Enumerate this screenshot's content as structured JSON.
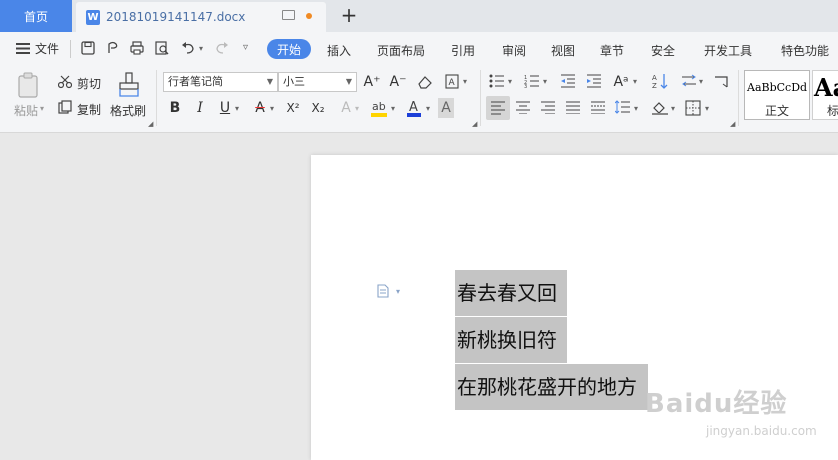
{
  "titlebar": {
    "home_tab": "首页",
    "doc_tab": {
      "filename": "20181019141147.docx",
      "app_icon_letter": "W",
      "unsaved_dot_color": "#f08a24"
    },
    "new_tab_symbol": "+"
  },
  "menubar": {
    "file_label": "文件",
    "tabs": [
      {
        "label": "开始"
      },
      {
        "label": "插入"
      },
      {
        "label": "页面布局"
      },
      {
        "label": "引用"
      },
      {
        "label": "审阅"
      },
      {
        "label": "视图"
      },
      {
        "label": "章节"
      },
      {
        "label": "安全"
      },
      {
        "label": "开发工具"
      },
      {
        "label": "特色功能"
      }
    ]
  },
  "ribbon": {
    "paste_label": "粘贴",
    "cut_label": "剪切",
    "copy_label": "复制",
    "format_painter_label": "格式刷",
    "font_family": "行者笔记简",
    "font_size": "小三",
    "bold": "B",
    "italic": "I",
    "underline": "U",
    "strike": "A",
    "superscript": "X²",
    "subscript": "X₂",
    "grow_font": "A⁺",
    "shrink_font": "A⁻",
    "font_color_letter": "A",
    "styles": [
      {
        "preview": "AaBbCcDd",
        "name": "正文"
      },
      {
        "preview": "Aa",
        "name": "标"
      }
    ]
  },
  "document": {
    "lines": [
      {
        "text": "春去春又回"
      },
      {
        "text": "新桃换旧符"
      },
      {
        "text": "在那桃花盛开的地方"
      }
    ]
  },
  "watermark": {
    "logo_text": "Baidu经验",
    "url_text": "jingyan.baidu.com"
  },
  "colors": {
    "accent": "#4a86e8",
    "selection": "#c4c4c4"
  }
}
